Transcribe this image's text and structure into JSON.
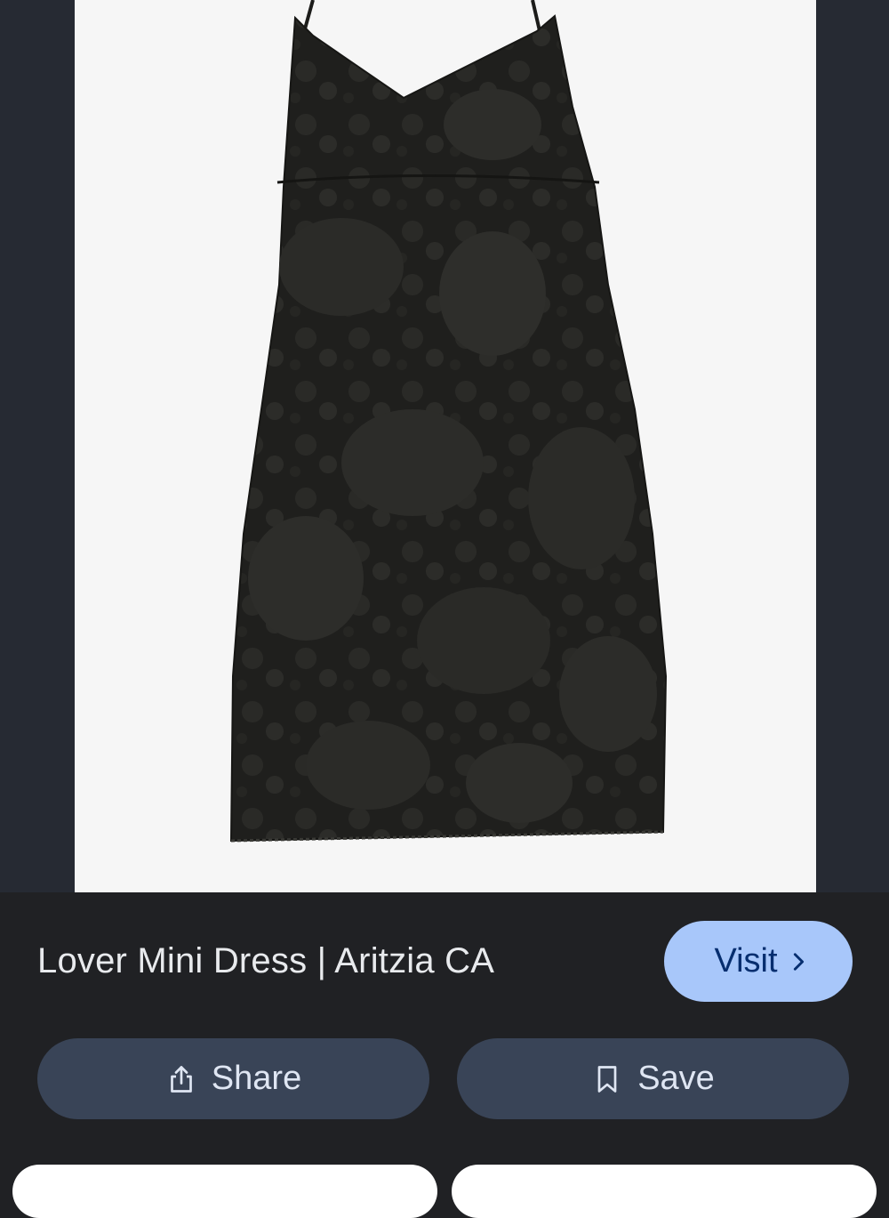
{
  "image_viewer": {
    "image_icon": "black-floral-mini-dress-image"
  },
  "result": {
    "title": "Lover Mini Dress | Aritzia CA",
    "visit_label": "Visit"
  },
  "actions": {
    "share_label": "Share",
    "share_icon": "share-icon",
    "save_label": "Save",
    "save_icon": "bookmark-icon"
  },
  "colors": {
    "background": "#202124",
    "viewer_background": "#262a33",
    "visit_button": "#a8c7fa",
    "action_button": "#394457"
  }
}
